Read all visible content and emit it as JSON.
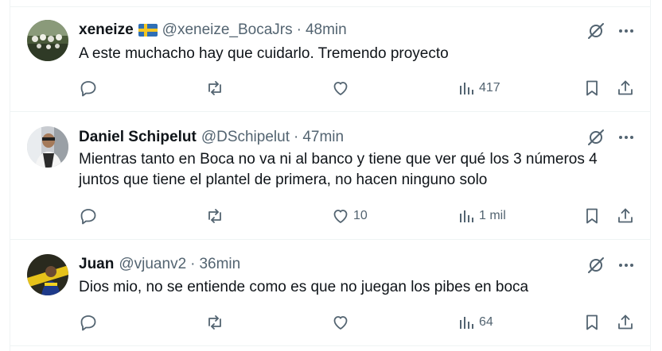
{
  "colors": {
    "text": "#0f1419",
    "muted": "#536471",
    "divider": "#eff3f4"
  },
  "tweets": [
    {
      "name": "xeneize",
      "flag": "sweden-flag",
      "handle": "@xeneize_BocaJrs",
      "separator": "·",
      "time": "48min",
      "text": "A este muchacho hay que cuidarlo. Tremendo proyecto",
      "replies": "",
      "retweets": "",
      "likes": "",
      "views": "417"
    },
    {
      "name": "Daniel Schipelut",
      "handle": "@DSchipelut",
      "separator": "·",
      "time": "47min",
      "text": "Mientras tanto en Boca no va ni al banco y tiene que ver qué los 3 números 4 juntos que tiene el plantel de primera, no hacen ninguno solo",
      "replies": "",
      "retweets": "",
      "likes": "10",
      "views": "1 mil"
    },
    {
      "name": "Juan",
      "handle": "@vjuanv2",
      "separator": "·",
      "time": "36min",
      "text": "Dios mio, no se entiende como es que no juegan los pibes en boca",
      "replies": "",
      "retweets": "",
      "likes": "",
      "views": "64"
    }
  ]
}
